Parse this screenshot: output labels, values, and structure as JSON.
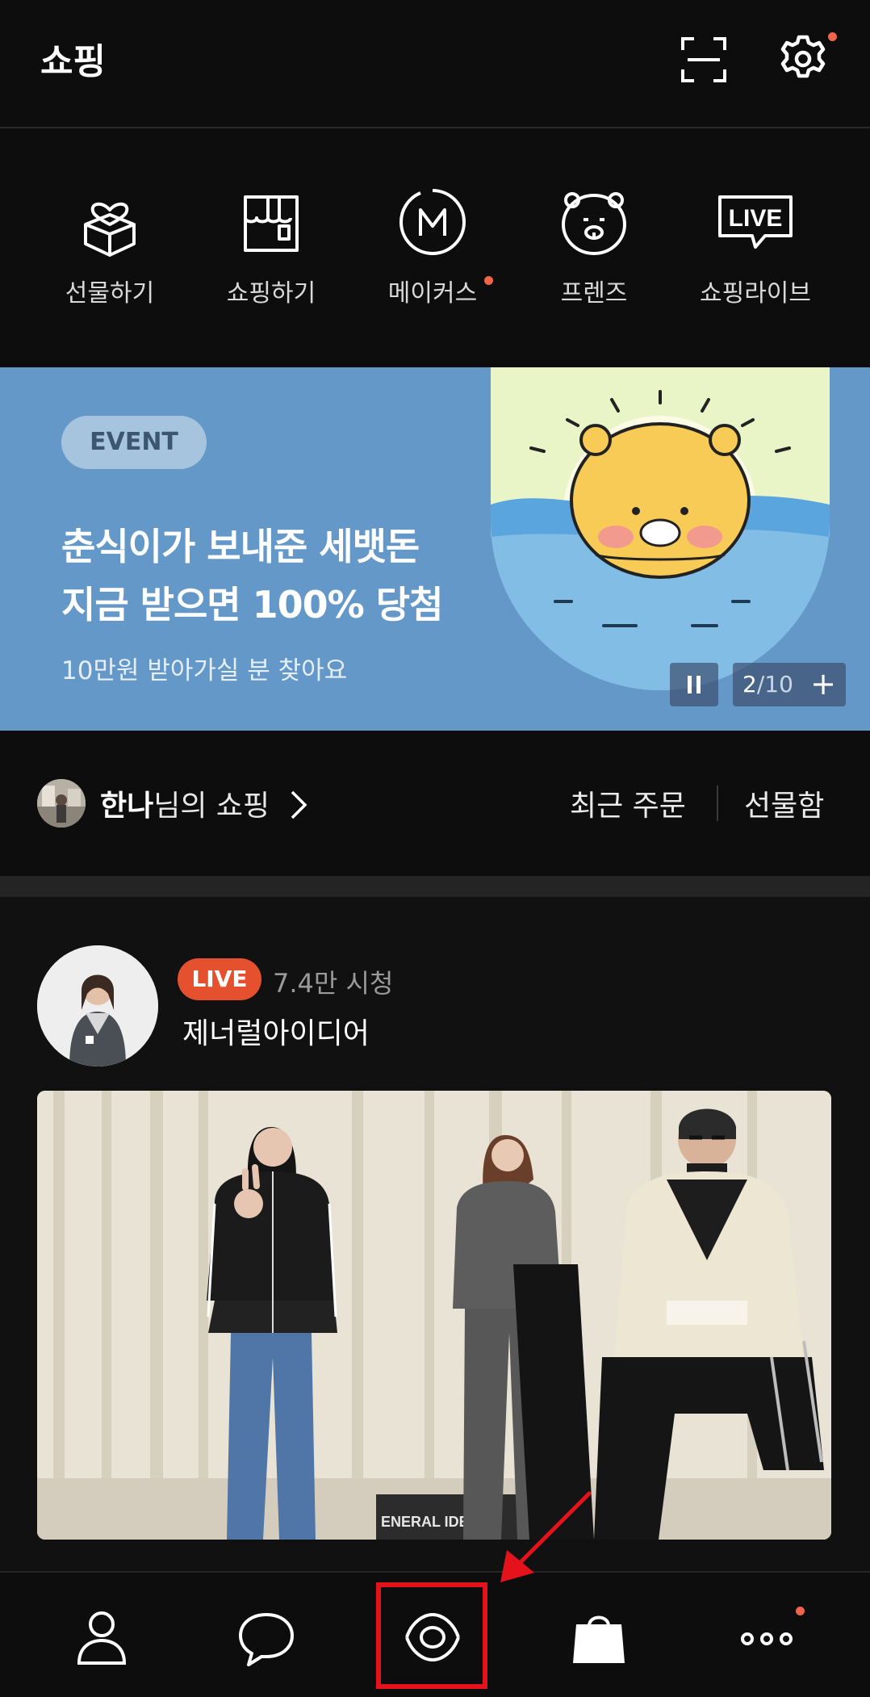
{
  "header": {
    "title": "쇼핑"
  },
  "categories": [
    {
      "label": "선물하기",
      "icon": "gift-icon"
    },
    {
      "label": "쇼핑하기",
      "icon": "store-icon"
    },
    {
      "label": "메이커스",
      "icon": "makers-icon",
      "has_dot": true
    },
    {
      "label": "프렌즈",
      "icon": "friends-icon"
    },
    {
      "label": "쇼핑라이브",
      "icon": "live-icon",
      "icon_text": "LIVE"
    }
  ],
  "banner": {
    "badge": "EVENT",
    "line1": "춘식이가 보내준 세뱃돈",
    "line2": "지금 받으면 100% 당첨",
    "subtitle": "10만원 받아가실 분 찾아요",
    "page_current": "2",
    "page_total": "/10",
    "plus": "+"
  },
  "user": {
    "name": "한나",
    "suffix": "님의 쇼핑",
    "recent_orders": "최근 주문",
    "gift_box": "선물함"
  },
  "live": {
    "badge": "LIVE",
    "viewers": "7.4만 시청",
    "host": "제너럴아이디어",
    "video_caption": "ENERAL IDEA"
  },
  "nav": {
    "items": [
      "profile-icon",
      "chat-icon",
      "view-icon",
      "shopping-bag-icon",
      "more-icon"
    ]
  },
  "colors": {
    "background": "#0d0d0d",
    "banner": "#6498c8",
    "accent_dot": "#f06449",
    "live_red": "#e5502f",
    "highlight": "#e3121b"
  }
}
